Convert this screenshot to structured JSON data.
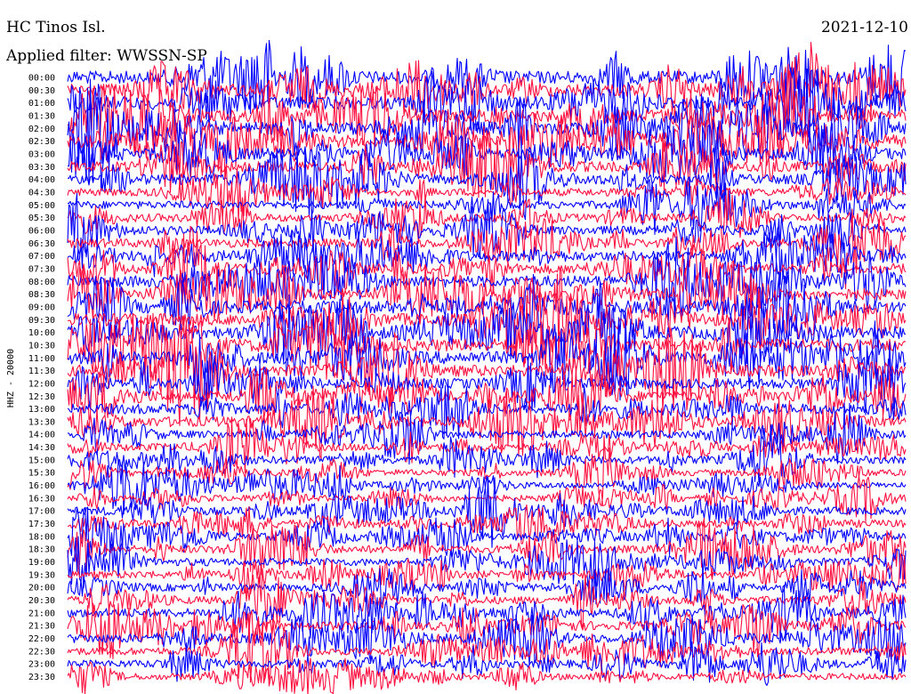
{
  "header": {
    "station": "HC Tinos Isl.",
    "filter": "Applied filter: WWSSN-SP",
    "date": "2021-12-10"
  },
  "channel_label": "HHZ - 20000",
  "colors": {
    "trace_a": "#0000ff",
    "trace_b": "#ff1040",
    "background": "#ffffff"
  },
  "chart_data": {
    "type": "line",
    "subtype": "helicorder",
    "title": "HC Tinos Isl.",
    "subtitle": "Applied filter: WWSSN-SP",
    "date": "2021-12-10",
    "ylabel": "HHZ - 20000",
    "row_labels": [
      "00:00",
      "00:30",
      "01:00",
      "01:30",
      "02:00",
      "02:30",
      "03:00",
      "03:30",
      "04:00",
      "04:30",
      "05:00",
      "05:30",
      "06:00",
      "06:30",
      "07:00",
      "07:30",
      "08:00",
      "08:30",
      "09:00",
      "09:30",
      "10:00",
      "10:30",
      "11:00",
      "11:30",
      "12:00",
      "12:30",
      "13:00",
      "13:30",
      "14:00",
      "14:30",
      "15:00",
      "15:30",
      "16:00",
      "16:30",
      "17:00",
      "17:30",
      "18:00",
      "18:30",
      "19:00",
      "19:30",
      "20:00",
      "20:30",
      "21:00",
      "21:30",
      "22:00",
      "22:30",
      "23:00",
      "23:30"
    ],
    "row_duration_minutes": 30,
    "trace_colors": [
      "#0000ff",
      "#ff1040"
    ],
    "relative_amplitude": [
      1.0,
      1.0,
      1.0,
      1.0,
      1.0,
      1.0,
      0.9,
      0.8,
      0.8,
      0.6,
      0.6,
      0.6,
      0.7,
      0.7,
      0.8,
      0.8,
      0.9,
      0.9,
      1.0,
      1.0,
      1.0,
      1.0,
      1.0,
      0.9,
      0.8,
      0.8,
      0.8,
      0.8,
      0.6,
      0.6,
      0.6,
      0.5,
      0.5,
      0.5,
      0.6,
      0.6,
      0.6,
      0.6,
      0.6,
      0.6,
      0.6,
      0.6,
      0.7,
      0.7,
      0.7,
      0.6,
      0.6,
      0.5
    ],
    "grid": false
  }
}
